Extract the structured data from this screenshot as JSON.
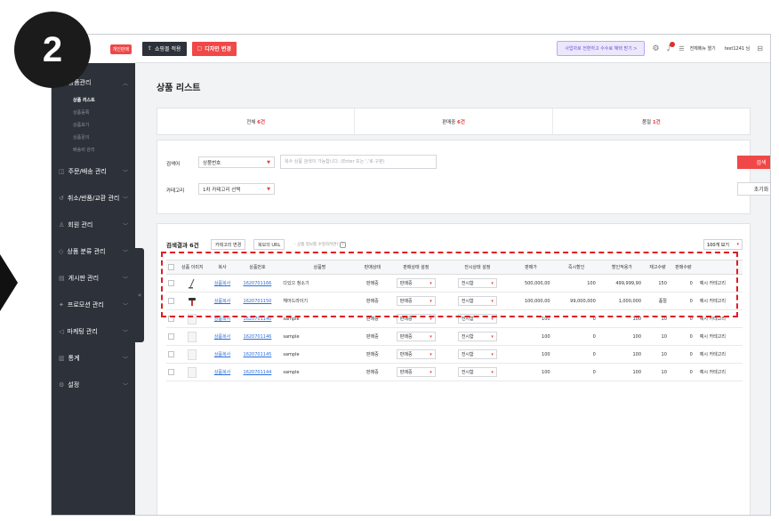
{
  "step_number": "2",
  "sidebar": {
    "shop_badge": "개인판매",
    "sections": [
      {
        "label": "상품관리",
        "sub": [
          "상품 리스트",
          "상품등록",
          "상품보기",
          "상품문의",
          "배송비 관리"
        ]
      },
      {
        "label": "주문/배송 관리"
      },
      {
        "label": "취소/반품/교환 관리"
      },
      {
        "label": "회원 관리"
      },
      {
        "label": "상품 분류 관리"
      },
      {
        "label": "게시판 관리"
      },
      {
        "label": "프로모션 관리"
      },
      {
        "label": "마케팅 관리"
      },
      {
        "label": "통계"
      },
      {
        "label": "설정"
      }
    ]
  },
  "topbar": {
    "shop_apply": "쇼핑몰 적용",
    "design_change": "디자인 변경",
    "promo": "사업자로 전환하고 수수료 혜택 받기 >",
    "menu_all": "전체메뉴 열기",
    "user": "test1241 님"
  },
  "page_title": "상품 리스트",
  "summary": [
    {
      "label": "전체",
      "count": "6건"
    },
    {
      "label": "판매중",
      "count": "6건"
    },
    {
      "label": "품절",
      "count": "1건"
    }
  ],
  "search": {
    "keyword_label": "검색어",
    "keyword_type": "상품번호",
    "keyword_placeholder": "복수 상품 검색이 가능합니다. (Enter 또는 ','로 구분)",
    "category_label": "카테고리",
    "category_value": "1차 카테고리 선택",
    "search_btn": "검색",
    "reset_btn": "초기화"
  },
  "results": {
    "title": "검색결과 6건",
    "btn_category": "카테고리 변경",
    "btn_url": "복모의 URL",
    "note": "- 상품 정보를 수정하려면?",
    "page_size": "100개 보기",
    "columns": [
      "상품 이미지",
      "복사",
      "상품번호",
      "상품명",
      "판매상태",
      "판매상태 설정",
      "전시상태 설정",
      "판매가",
      "즉시할인",
      "할인적용가",
      "재고수량",
      "판매수량",
      ""
    ],
    "rows": [
      {
        "copy": "상품복사",
        "no": "1620701166",
        "name": "다있으 청소기",
        "status": "판매중",
        "sale_set": "판매중",
        "display_set": "전시함",
        "price": "500,000,00",
        "discount": "100",
        "final": "499,999,90",
        "stock": "150",
        "sold": "0",
        "category": "예시 카테고리"
      },
      {
        "copy": "상품복사",
        "no": "1620701150",
        "name": "헤어드라이기",
        "status": "판매중",
        "sale_set": "판매중",
        "display_set": "전시함",
        "price": "100,000,00",
        "discount": "99,000,000",
        "final": "1,000,000",
        "stock": "품절",
        "sold": "0",
        "category": "예시 카테고리"
      },
      {
        "copy": "상품복사",
        "no": "1620701140",
        "name": "sample",
        "status": "판매중",
        "sale_set": "판매중",
        "display_set": "전시함",
        "price": "100",
        "discount": "0",
        "final": "100",
        "stock": "10",
        "sold": "0",
        "category": "예시 카테고리"
      },
      {
        "copy": "상품복사",
        "no": "1620701146",
        "name": "sample",
        "status": "판매중",
        "sale_set": "판매중",
        "display_set": "전시함",
        "price": "100",
        "discount": "0",
        "final": "100",
        "stock": "10",
        "sold": "0",
        "category": "예시 카테고리"
      },
      {
        "copy": "상품복사",
        "no": "1620701145",
        "name": "sample",
        "status": "판매중",
        "sale_set": "판매중",
        "display_set": "전시함",
        "price": "100",
        "discount": "0",
        "final": "100",
        "stock": "10",
        "sold": "0",
        "category": "예시 카테고리"
      },
      {
        "copy": "상품복사",
        "no": "1620701144",
        "name": "sample",
        "status": "판매중",
        "sale_set": "판매중",
        "display_set": "전시함",
        "price": "100",
        "discount": "0",
        "final": "100",
        "stock": "10",
        "sold": "0",
        "category": "예시 카테고리"
      }
    ]
  },
  "colors": {
    "accent": "#f04848",
    "sidebar": "#2d3139",
    "highlight": "#e01b24"
  }
}
